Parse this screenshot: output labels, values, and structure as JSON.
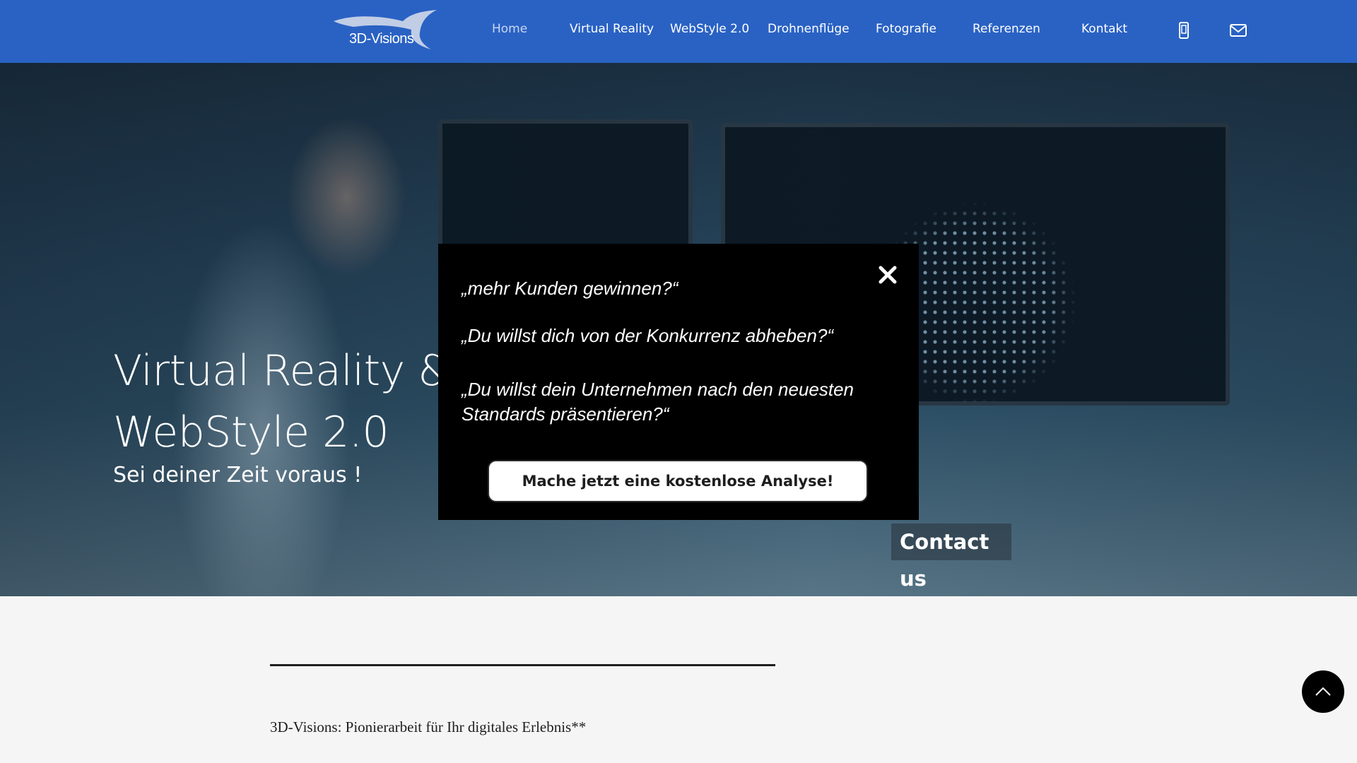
{
  "header": {
    "logo_text": "3D-Visions",
    "nav": [
      {
        "label": "Home",
        "active": true
      },
      {
        "label": "Virtual Reality"
      },
      {
        "label": "WebStyle 2.0"
      },
      {
        "label": "Drohnenflüge"
      },
      {
        "label": "Fotografie"
      },
      {
        "label": "Referenzen"
      },
      {
        "label": "Kontakt"
      }
    ],
    "icons": [
      "phone-icon",
      "mail-icon"
    ]
  },
  "hero": {
    "title": "Virtual Reality & WebStyle 2.0",
    "subtitle": "Sei deiner Zeit voraus !",
    "contact_label": "Contact us"
  },
  "popup": {
    "lines": [
      "„mehr Kunden gewinnen?“",
      "„Du willst dich von der Konkurrenz abheben?“",
      "„Du willst dein Unternehmen nach den neuesten Standards präsentieren?“"
    ],
    "cta_label": "Mache jetzt eine kostenlose Analyse!",
    "close_icon": "close-icon"
  },
  "content": {
    "intro": "3D-Visions: Pionierarbeit für Ihr digitales Erlebnis**"
  },
  "colors": {
    "header_bg": "#2a62c4",
    "popup_bg": "#000000",
    "page_bg": "#f5f5f5"
  }
}
